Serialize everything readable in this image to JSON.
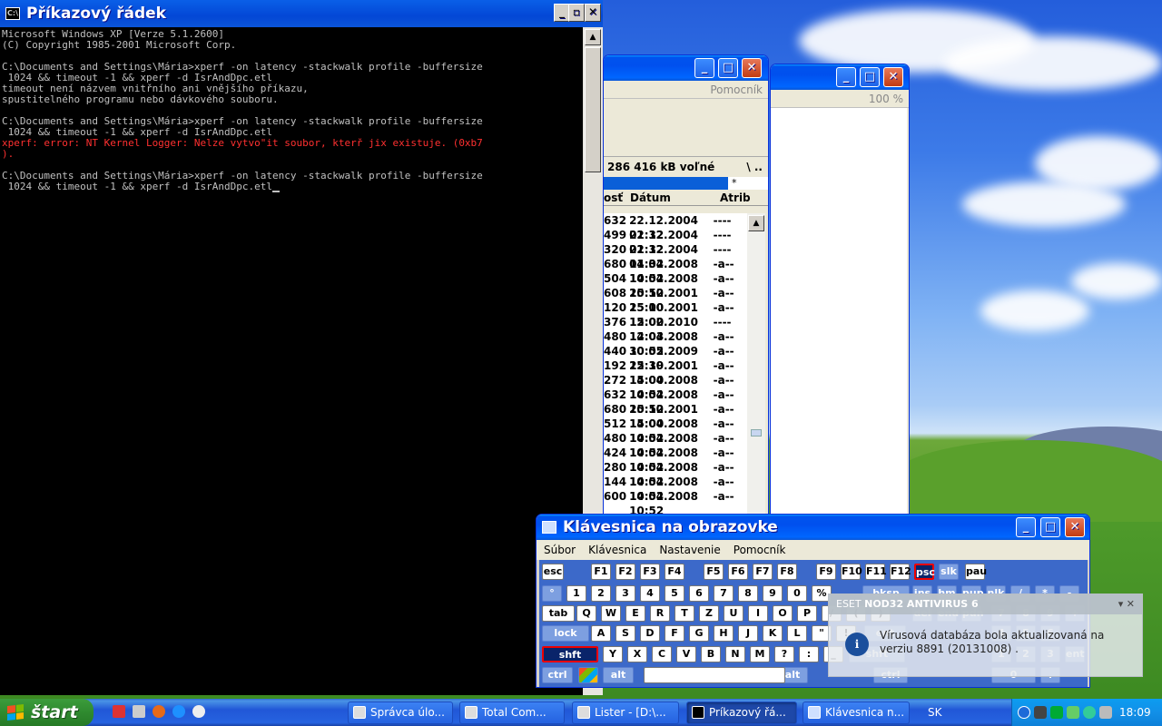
{
  "cmd": {
    "title": "Příkazový řádek",
    "lines": [
      "Microsoft Windows XP [Verze 5.1.2600]",
      "(C) Copyright 1985-2001 Microsoft Corp.",
      "",
      "C:\\Documents and Settings\\Mária>xperf -on latency -stackwalk profile -buffersize",
      " 1024 && timeout -1 && xperf -d IsrAndDpc.etl",
      "timeout není názvem vnitřního ani vnějšího příkazu,",
      "spustitelného programu nebo dávkového souboru.",
      "",
      "C:\\Documents and Settings\\Mária>xperf -on latency -stackwalk profile -buffersize",
      " 1024 && timeout -1 && xperf -d IsrAndDpc.etl"
    ],
    "error_lines": [
      "xperf: error: NT Kernel Logger: Nelze vytvo\"it soubor, kterř jix existuje. (0xb7",
      ")."
    ],
    "last_lines": [
      "",
      "C:\\Documents and Settings\\Mária>xperf -on latency -stackwalk profile -buffersize",
      " 1024 && timeout -1 && xperf -d IsrAndDpc.etl"
    ]
  },
  "lister": {
    "menu_help": "Pomocník",
    "free_space": "286 416 kB voľné",
    "path_marks": "\\  ..",
    "filter": "*",
    "columns": [
      "osť",
      "Dátum",
      "Atrib"
    ],
    "rows": [
      [
        "632",
        "22.12.2004 01:32",
        "----"
      ],
      [
        "499",
        "22.12.2004 01:32",
        "----"
      ],
      [
        "320",
        "22.12.2004 01:32",
        "----"
      ],
      [
        "680",
        "14.04.2008 10:52",
        "-a--"
      ],
      [
        "504",
        "14.04.2008 10:52",
        "-a--"
      ],
      [
        "608",
        "25.10.2001 15:00",
        "-a--"
      ],
      [
        "120",
        "25.10.2001 15:00",
        "-a--"
      ],
      [
        "376",
        "12.02.2010 12:03",
        "----"
      ],
      [
        "480",
        "14.04.2008 10:52",
        "-a--"
      ],
      [
        "440",
        "30.05.2009 12:39",
        "-a--"
      ],
      [
        "192",
        "25.10.2001 15:00",
        "-a--"
      ],
      [
        "272",
        "14.04.2008 10:52",
        "-a--"
      ],
      [
        "632",
        "14.04.2008 10:52",
        "-a--"
      ],
      [
        "680",
        "25.10.2001 15:00",
        "-a--"
      ],
      [
        "512",
        "14.04.2008 10:52",
        "-a--"
      ],
      [
        "480",
        "14.04.2008 10:52",
        "-a--"
      ],
      [
        "424",
        "14.04.2008 10:52",
        "-a--"
      ],
      [
        "280",
        "14.04.2008 10:52",
        "-a--"
      ],
      [
        "144",
        "14.04.2008 10:52",
        "-a--"
      ],
      [
        "600",
        "14.04.2008 10:52",
        "-a--"
      ]
    ]
  },
  "spravca": {
    "zoom": "100 %"
  },
  "osk": {
    "title": "Klávesnica na obrazovke",
    "menu": [
      "Súbor",
      "Klávesnica",
      "Nastavenie",
      "Pomocník"
    ],
    "row0": [
      "esc",
      "F1",
      "F2",
      "F3",
      "F4",
      "F5",
      "F6",
      "F7",
      "F8",
      "F9",
      "F10",
      "F11",
      "F12",
      "psc",
      "slk",
      "pau"
    ],
    "row1": [
      "°",
      "1",
      "2",
      "3",
      "4",
      "5",
      "6",
      "7",
      "8",
      "9",
      "0",
      "%",
      "bksp",
      "ins",
      "hm",
      "pup",
      "nlk",
      "/",
      "*",
      "-"
    ],
    "row2": [
      "tab",
      "Q",
      "W",
      "E",
      "R",
      "T",
      "Z",
      "U",
      "I",
      "O",
      "P",
      "/",
      "(",
      ")",
      "del",
      "end",
      "pdn",
      "7",
      "8",
      "9",
      "+"
    ],
    "row3": [
      "lock",
      "A",
      "S",
      "D",
      "F",
      "G",
      "H",
      "J",
      "K",
      "L",
      "\"",
      "!",
      "ent",
      "4",
      "5",
      "6"
    ],
    "row4": [
      "shft",
      "Y",
      "X",
      "C",
      "V",
      "B",
      "N",
      "M",
      "?",
      ":",
      "_",
      "shft",
      "1",
      "2",
      "3",
      "ent"
    ],
    "row5": [
      "ctrl",
      "alt",
      "alt",
      "ctrl",
      "0",
      "."
    ]
  },
  "notification": {
    "title_prefix": "ESET ",
    "title_bold": "NOD32 ANTIVIRUS 6",
    "message": "Vírusová databáza bola aktualizovaná na verziu 8891 (20131008) ."
  },
  "taskbar": {
    "start": "štart",
    "buttons": [
      "Správca úlo...",
      "Total Com...",
      "Lister - [D:\\...",
      "Príkazový řá...",
      "Klávesnica n..."
    ],
    "lang": "SK",
    "clock": "18:09"
  },
  "colors": {
    "console_bg": "#000000",
    "console_text": "#c0c0c0",
    "error_text": "#ff3030",
    "xp_blue": "#0053ee"
  }
}
